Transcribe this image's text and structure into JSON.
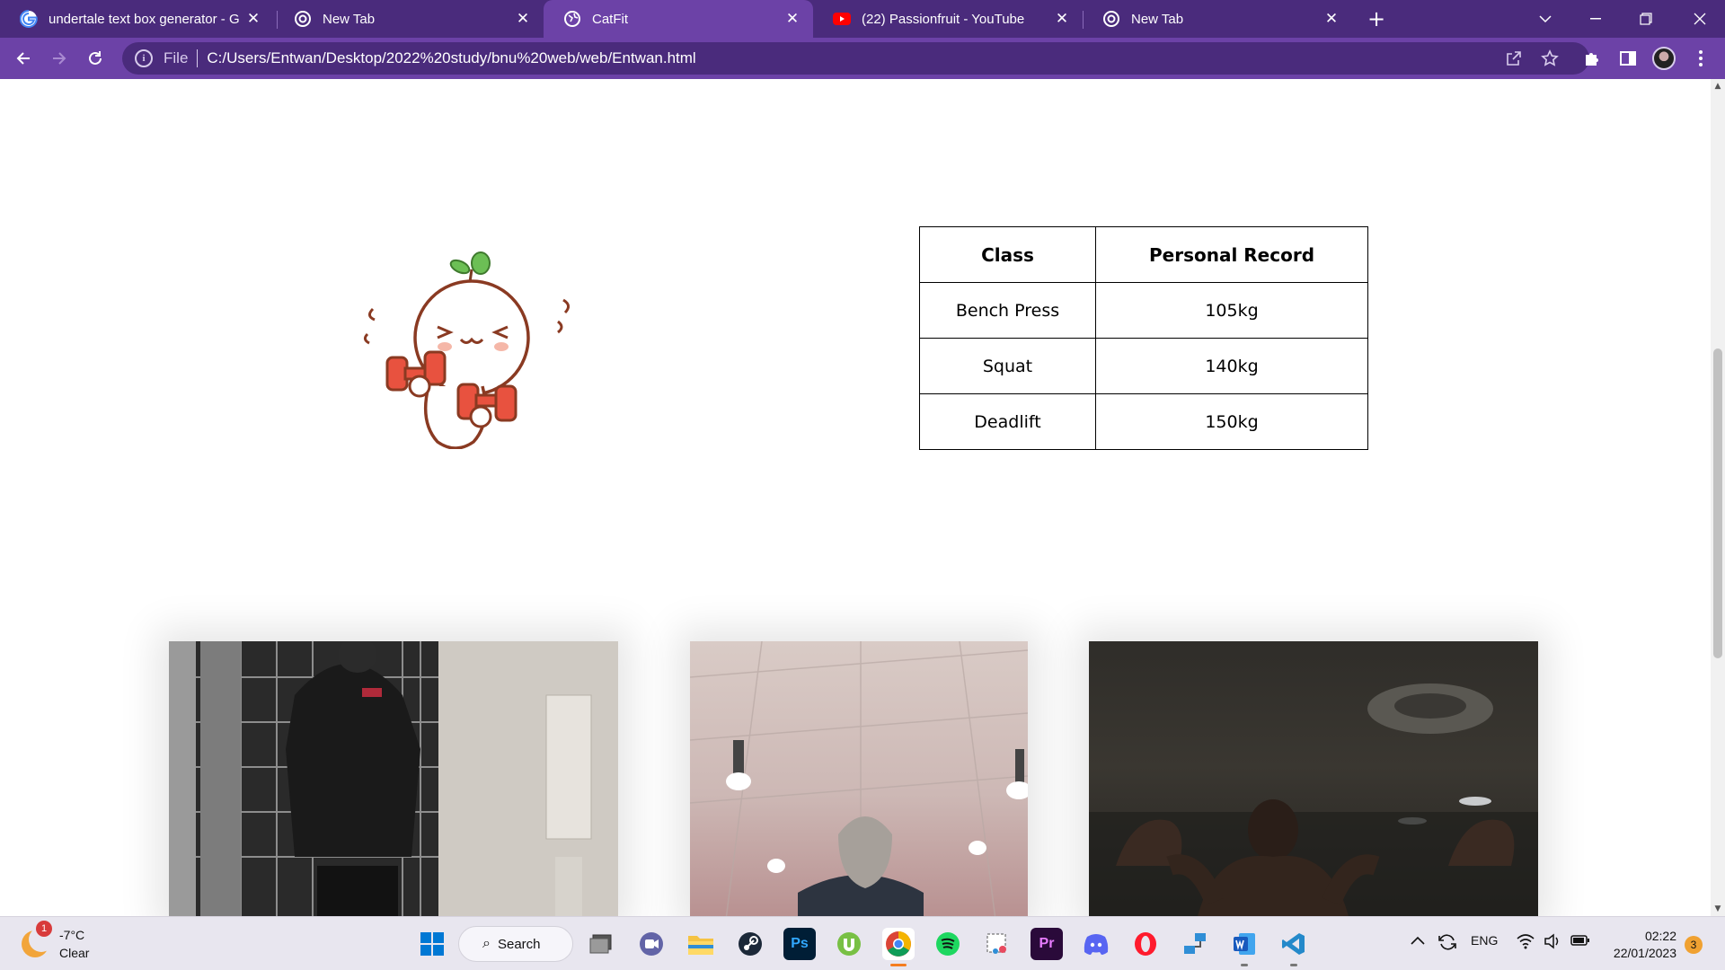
{
  "browser": {
    "tabs": [
      {
        "title": "undertale text box generator - Go",
        "icon": "google-icon",
        "active": false
      },
      {
        "title": "New Tab",
        "icon": "chrome-icon",
        "active": false
      },
      {
        "title": "CatFit",
        "icon": "globe-icon",
        "active": true
      },
      {
        "title": "(22) Passionfruit - YouTube",
        "icon": "youtube-icon",
        "active": false
      },
      {
        "title": "New Tab",
        "icon": "chrome-icon",
        "active": false
      }
    ],
    "new_tab_label": "+",
    "address": {
      "scheme_label": "File",
      "url": "C:/Users/Entwan/Desktop/2022%20study/bnu%20web/web/Entwan.html"
    },
    "theme_colors": {
      "frame": "#4a2b7c",
      "toolbar": "#6c42a7"
    }
  },
  "page": {
    "table": {
      "headers": [
        "Class",
        "Personal Record"
      ],
      "rows": [
        [
          "Bench Press",
          "105kg"
        ],
        [
          "Squat",
          "140kg"
        ],
        [
          "Deadlift",
          "150kg"
        ]
      ]
    },
    "mascot_icon": "cat-lifting-dumbbells-illustration",
    "photos": [
      "gym-mirror-selfie-photo",
      "gym-ceiling-photo",
      "gym-flex-photo"
    ]
  },
  "taskbar": {
    "weather": {
      "temp": "-7°C",
      "condition": "Clear",
      "badge": "1"
    },
    "search_label": "Search",
    "apps": [
      "windows-start",
      "task-view",
      "teams-chat",
      "file-explorer",
      "steam",
      "photoshop",
      "utorrent",
      "chrome",
      "spotify",
      "snipping-tool",
      "premiere-pro",
      "discord",
      "opera",
      "network-tool",
      "word",
      "vscode"
    ],
    "tray": {
      "language": "ENG"
    },
    "clock": {
      "time": "02:22",
      "date": "22/01/2023"
    },
    "notifications": "3"
  }
}
